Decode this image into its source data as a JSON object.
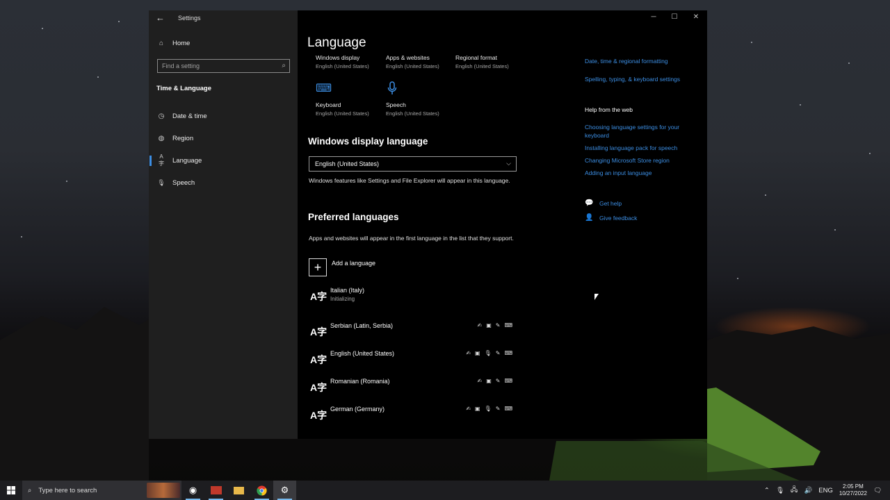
{
  "window": {
    "app_title": "Settings",
    "back_icon": "back-arrow-icon",
    "controls": {
      "minimize": "─",
      "maximize": "☐",
      "close": "✕"
    }
  },
  "sidebar": {
    "home_label": "Home",
    "search_placeholder": "Find a setting",
    "section_title": "Time & Language",
    "items": [
      {
        "label": "Date & time",
        "icon": "calendar-clock-icon",
        "glyph": "◷",
        "active": false
      },
      {
        "label": "Region",
        "icon": "globe-icon",
        "glyph": "◍",
        "active": false
      },
      {
        "label": "Language",
        "icon": "language-icon",
        "glyph": "A字",
        "active": true
      },
      {
        "label": "Speech",
        "icon": "microphone-icon",
        "glyph": "🎙",
        "active": false
      }
    ]
  },
  "main": {
    "title": "Language",
    "tiles": [
      {
        "label": "Windows display",
        "value": "English (United States)"
      },
      {
        "label": "Apps & websites",
        "value": "English (United States)"
      },
      {
        "label": "Regional format",
        "value": "English (United States)"
      },
      {
        "label": "Keyboard",
        "value": "English (United States)",
        "icon": "keyboard-icon"
      },
      {
        "label": "Speech",
        "value": "English (United States)",
        "icon": "microphone-icon"
      }
    ],
    "display_language": {
      "heading": "Windows display language",
      "selected": "English (United States)",
      "description": "Windows features like Settings and File Explorer will appear in this language."
    },
    "preferred": {
      "heading": "Preferred languages",
      "description": "Apps and websites will appear in the first language in the list that they support.",
      "add_label": "Add a language",
      "languages": [
        {
          "name": "Italian (Italy)",
          "status": "Initializing",
          "features": []
        },
        {
          "name": "Serbian (Latin, Serbia)",
          "status": "",
          "features": [
            "display-language-icon",
            "text-to-speech-icon",
            "handwriting-icon",
            "basic-typing-icon"
          ]
        },
        {
          "name": "English (United States)",
          "status": "",
          "features": [
            "display-language-icon",
            "text-to-speech-icon",
            "speech-recognition-icon",
            "handwriting-icon",
            "basic-typing-icon"
          ]
        },
        {
          "name": "Romanian (Romania)",
          "status": "",
          "features": [
            "display-language-icon",
            "text-to-speech-icon",
            "handwriting-icon",
            "basic-typing-icon"
          ]
        },
        {
          "name": "German (Germany)",
          "status": "",
          "features": [
            "display-language-icon",
            "text-to-speech-icon",
            "speech-recognition-icon",
            "handwriting-icon",
            "basic-typing-icon"
          ]
        }
      ]
    }
  },
  "related": {
    "links": [
      "Date, time & regional formatting",
      "Spelling, typing, & keyboard settings"
    ],
    "help_heading": "Help from the web",
    "help_links": [
      "Choosing language settings for your keyboard",
      "Installing language pack for speech",
      "Changing Microsoft Store region",
      "Adding an input language"
    ],
    "get_help": "Get help",
    "give_feedback": "Give feedback"
  },
  "taskbar": {
    "search_placeholder": "Type here to search",
    "tray": {
      "language": "ENG",
      "time": "2:05 PM",
      "date": "10/27/2022"
    }
  },
  "colors": {
    "accent": "#3c8ee3",
    "window_bg": "#000000",
    "sidebar_bg": "#1f1f1f",
    "taskbar_bg": "#1d1d20"
  }
}
